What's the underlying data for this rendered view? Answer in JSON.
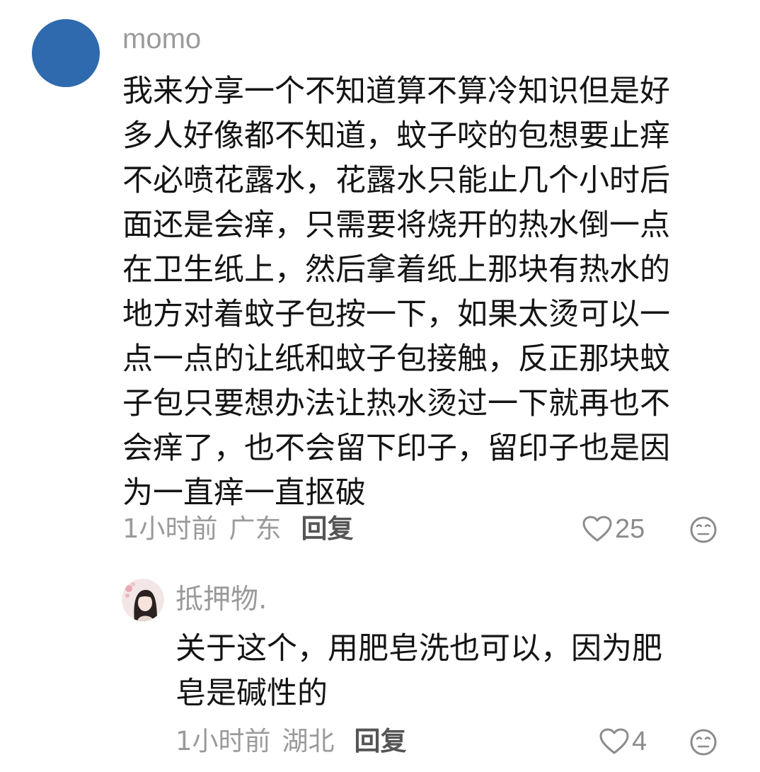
{
  "main_comment": {
    "username": "momo",
    "avatar_color": "#2e6aad",
    "lines": [
      "我来分享一个不知道算不算冷知识但是好",
      "多人好像都不知道，蚊子咬的包想要止痒",
      "不必喷花露水，花露水只能止几个小时后",
      "面还是会痒，只需要将烧开的热水倒一点",
      "在卫生纸上，然后拿着纸上那块有热水的",
      "地方对着蚊子包按一下，如果太烫可以一",
      "点一点的让纸和蚊子包接触，反正那块蚊",
      "子包只要想办法让热水烫过一下就再也不",
      "会痒了，也不会留下印子，留印子也是因",
      "为一直痒一直抠破"
    ],
    "time": "1小时前",
    "location": "广东",
    "reply_label": "回复",
    "like_icon": "heart-outline-icon",
    "like_count": "25",
    "emoji_icon": "neutral-face-icon"
  },
  "reply_comment": {
    "username": "抵押物.",
    "avatar_icon": "profile-photo",
    "lines": [
      "关于这个，用肥皂洗也可以，因为肥",
      "皂是碱性的"
    ],
    "time": "1小时前",
    "location": "湖北",
    "reply_label": "回复",
    "like_icon": "heart-outline-icon",
    "like_count": "4",
    "emoji_icon": "neutral-face-icon"
  },
  "colors": {
    "text_primary": "#141414",
    "text_secondary": "#9a9a9a",
    "reply_label": "#555555",
    "icon": "#8c8c8c"
  }
}
